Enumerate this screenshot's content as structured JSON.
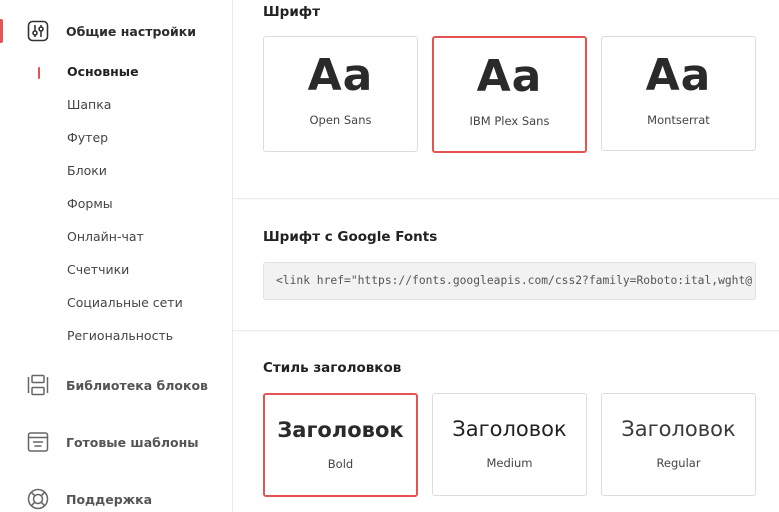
{
  "sidebar": {
    "general": {
      "label": "Общие настройки",
      "icon": "sliders-icon"
    },
    "sub_items": [
      {
        "label": "Основные",
        "active": true
      },
      {
        "label": "Шапка"
      },
      {
        "label": "Футер"
      },
      {
        "label": "Блоки"
      },
      {
        "label": "Формы"
      },
      {
        "label": "Онлайн-чат"
      },
      {
        "label": "Счетчики"
      },
      {
        "label": "Социальные сети"
      },
      {
        "label": "Региональность"
      }
    ],
    "library": {
      "label": "Библиотека блоков",
      "icon": "blocks-library-icon"
    },
    "templates": {
      "label": "Готовые шаблоны",
      "icon": "templates-icon"
    },
    "support": {
      "label": "Поддержка",
      "icon": "lifebuoy-icon"
    }
  },
  "font_section": {
    "heading": "Шрифт",
    "cards": [
      {
        "sample": "Aa",
        "name": "Open Sans"
      },
      {
        "sample": "Aa",
        "name": "IBM Plex Sans",
        "selected": true
      },
      {
        "sample": "Aa",
        "name": "Montserrat"
      }
    ]
  },
  "google_fonts": {
    "heading": "Шрифт с Google Fonts",
    "value": "<link href=\"https://fonts.googleapis.com/css2?family=Roboto:ital,wght@"
  },
  "heading_style": {
    "heading": "Стиль заголовков",
    "cards": [
      {
        "title": "Заголовок",
        "weight": "Bold",
        "selected": true
      },
      {
        "title": "Заголовок",
        "weight": "Medium"
      },
      {
        "title": "Заголовок",
        "weight": "Regular"
      }
    ]
  },
  "colors": {
    "accent": "#e55353"
  }
}
